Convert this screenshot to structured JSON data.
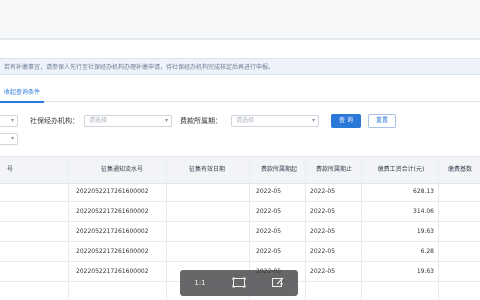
{
  "notice": {
    "text": "若有补缴事宜，请参保人先行至社保经办机构办理补缴申请，待社保经办机构完成核定后再进行申报。"
  },
  "tabs": [
    {
      "label": "收起查询条件"
    }
  ],
  "filters": {
    "agency_label": "社保经办机构：",
    "agency_placeholder": "请选择",
    "period_label": "费款所属期：",
    "period_placeholder": "请选择",
    "search_label": "查 询",
    "reset_label": "重置"
  },
  "table": {
    "headers": [
      "号",
      "征集通知流水号",
      "征集有效日期",
      "费款所属期起",
      "费款所属期止",
      "缴费工资合计(元)",
      "缴费基数"
    ],
    "rows": [
      {
        "serial": "2022052217261600002",
        "valid_date": "",
        "start": "2022-05",
        "end": "2022-05",
        "amount": "628.13"
      },
      {
        "serial": "2022052217261600002",
        "valid_date": "",
        "start": "2022-05",
        "end": "2022-05",
        "amount": "314.06"
      },
      {
        "serial": "2022052217261600002",
        "valid_date": "",
        "start": "2022-05",
        "end": "2022-05",
        "amount": "19.63"
      },
      {
        "serial": "2022052217261600002",
        "valid_date": "",
        "start": "2022-05",
        "end": "2022-05",
        "amount": "6.28"
      },
      {
        "serial": "2022052217261600002",
        "valid_date": "",
        "start": "2022-05",
        "end": "2022-05",
        "amount": "19.63"
      }
    ]
  },
  "viewer": {
    "actual_size_label": "1:1",
    "icons": [
      "actual-size-icon",
      "fit-screen-icon",
      "edit-icon"
    ]
  },
  "colors": {
    "accent": "#2a78d8",
    "header_bg": "#f2f4f8"
  }
}
